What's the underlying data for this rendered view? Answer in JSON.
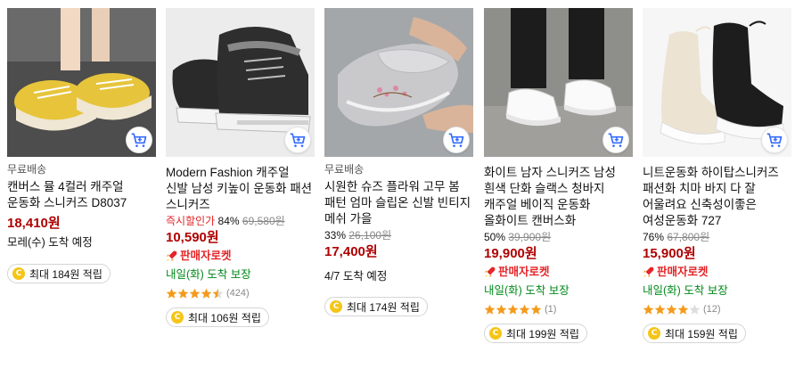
{
  "products": [
    {
      "tag": "무료배송",
      "title": "캔버스 뮬 4컬러 캐주얼 운동화 스니커즈 D8037",
      "sale_label": "",
      "discount": "",
      "original_price": "",
      "price": "18,410원",
      "rocket": "",
      "delivery": "모레(수) 도착 예정",
      "delivery_green": false,
      "stars": 0,
      "review_count": "",
      "reward": "최대 184원 적립",
      "photo_bg": "#4b4b4b",
      "cart_icon": "cart-add-icon"
    },
    {
      "tag": "",
      "title": "Modern Fashion 캐주얼 신발 남성 키높이 운동화 패션 스니커즈",
      "sale_label": "즉시할인가",
      "discount": "84%",
      "original_price": "69,580원",
      "price": "10,590원",
      "rocket": "판매자로켓",
      "delivery": "내일(화) 도착 보장",
      "delivery_green": true,
      "stars": 4.5,
      "review_count": "(424)",
      "reward": "최대 106원 적립",
      "photo_bg": "#e9e9e9",
      "cart_icon": "cart-add-icon"
    },
    {
      "tag": "무료배송",
      "title": "시원한 슈즈 플라워 고무 봄 패턴 엄마 슬립온 신발 빈티지 메쉬 가을",
      "sale_label": "",
      "discount": "33%",
      "original_price": "26,100원",
      "price": "17,400원",
      "rocket": "",
      "delivery": "4/7 도착 예정",
      "delivery_green": false,
      "stars": 0,
      "review_count": "",
      "reward": "최대 174원 적립",
      "photo_bg": "#9ea3a6",
      "cart_icon": "cart-add-icon"
    },
    {
      "tag": "",
      "title": "화이트 남자 스니커즈 남성 흰색 단화 슬랙스 청바지 캐주얼 베이직 운동화 올화이트 캔버스화",
      "sale_label": "",
      "discount": "50%",
      "original_price": "39,900원",
      "price": "19,900원",
      "rocket": "판매자로켓",
      "delivery": "내일(화) 도착 보장",
      "delivery_green": true,
      "stars": 5,
      "review_count": "(1)",
      "reward": "최대 199원 적립",
      "photo_bg": "#8f8f8c",
      "cart_icon": "cart-add-icon"
    },
    {
      "tag": "",
      "title": "니트운동화 하이탑스니커즈 패션화 치마 바지 다 잘 어울려요 신축성이좋은 여성운동화 727",
      "sale_label": "",
      "discount": "76%",
      "original_price": "67,800원",
      "price": "15,900원",
      "rocket": "판매자로켓",
      "delivery": "내일(화) 도착 보장",
      "delivery_green": true,
      "stars": 4,
      "review_count": "(12)",
      "reward": "최대 159원 적립",
      "photo_bg": "#f4f4f4",
      "cart_icon": "cart-add-icon"
    }
  ],
  "colors": {
    "price": "#ae0000",
    "rocket": "#e52528",
    "delivery_green": "#00891a",
    "star": "#f49a1b",
    "cart": "#346aff"
  }
}
